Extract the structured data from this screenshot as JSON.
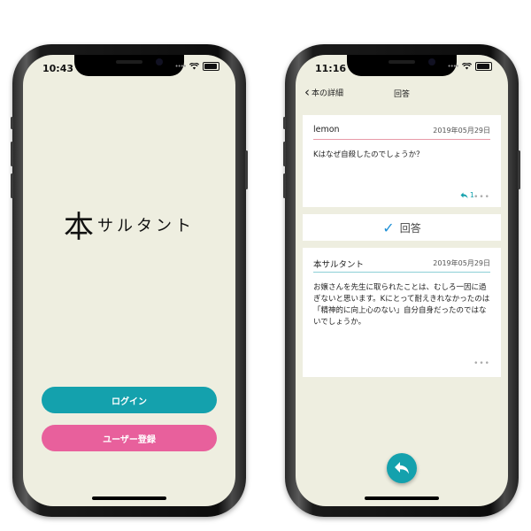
{
  "left_phone": {
    "status_time": "10:43",
    "logo_big": "本",
    "logo_small": "サルタント",
    "login_label": "ログイン",
    "register_label": "ユーザー登録"
  },
  "right_phone": {
    "status_time": "11:16",
    "nav": {
      "back_label": "本の詳細",
      "title": "回答"
    },
    "question": {
      "user": "lemon",
      "date": "2019年05月29日",
      "text": "Kはなぜ自殺したのでしょうか？",
      "reply_count": "1"
    },
    "answer_label": "回答",
    "answer": {
      "user": "本サルタント",
      "date": "2019年05月29日",
      "text": "お嬢さんを先生に取られたことは、むしろ一因に過ぎないと思います。Kにとって耐えきれなかったのは「精神的に向上心のない」自分自身だったのではないでしょうか。"
    }
  },
  "colors": {
    "screen_bg": "#eeeee0",
    "teal": "#14a1ad",
    "pink": "#e8609c",
    "check_blue": "#1e90d6"
  },
  "icons": [
    "wifi-icon",
    "battery-icon",
    "back-chevron-icon",
    "reply-icon",
    "more-icon",
    "checkmark-icon"
  ]
}
